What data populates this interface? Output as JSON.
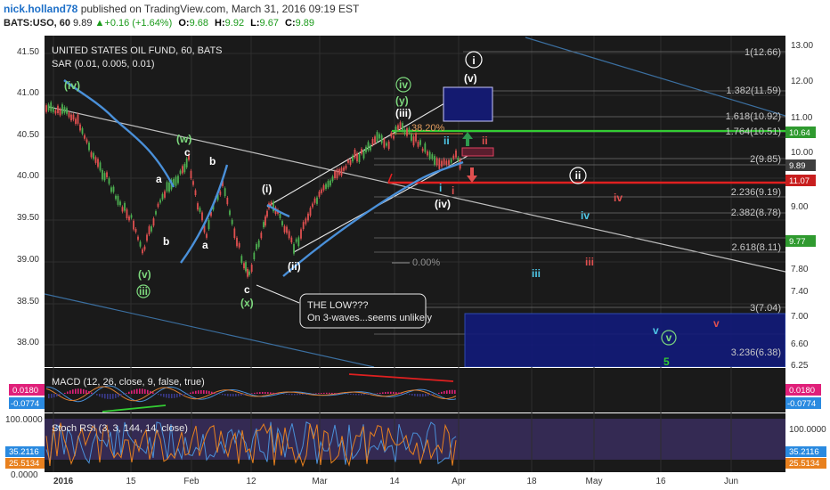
{
  "header": {
    "author": "nick.holland78",
    "published": "published on TradingView.com, March 31, 2016 09:19 EST",
    "symbol": "BATS:USO, 60",
    "last": "9.89",
    "change": "+0.16 (+1.64%)",
    "o_label": "O:",
    "o": "9.68",
    "h_label": "H:",
    "h": "9.92",
    "l_label": "L:",
    "l": "9.67",
    "c_label": "C:",
    "c": "9.89"
  },
  "chart": {
    "title": "UNITED STATES OIL FUND, 60, BATS",
    "sar_label": "SAR (0.01, 0.005, 0.01)",
    "left_ticks": [
      "41.50",
      "41.00",
      "40.50",
      "40.00",
      "39.50",
      "39.00",
      "38.50",
      "38.00"
    ],
    "right_ticks": [
      "13.00",
      "12.00",
      "11.00",
      "10.00",
      "9.00",
      "7.80",
      "7.40",
      "7.00",
      "6.60",
      "6.25"
    ],
    "price_tags": [
      "10.64",
      "9.89",
      "11.07",
      "9.77"
    ],
    "fib_levels": [
      "1(12.66)",
      "1.382(11.59)",
      "1.618(10.92)",
      "1.764(10.51)",
      "2(9.85)",
      "2.236(9.19)",
      "2.382(8.78)",
      "2.618(8.11)",
      "3(7.04)",
      "3.236(6.38)"
    ],
    "fib_38": "38.20%",
    "fib_0": "0.00%",
    "annotation_title": "THE LOW???",
    "annotation_text": "On 3-waves...seems unlikely",
    "x_ticks": [
      "2016",
      "15",
      "Feb",
      "12",
      "Mar",
      "14",
      "Apr",
      "18",
      "May",
      "16",
      "Jun"
    ]
  },
  "waves": {
    "iv_green": "(iv)",
    "w_green": "(w)",
    "v_green": "(v)",
    "iii_green": "iii",
    "x_green": "(x)",
    "c_white": "c",
    "a1": "a",
    "b1": "b",
    "b2": "b",
    "a2": "a",
    "c2": "c",
    "i_paren": "(i)",
    "ii_paren": "(ii)",
    "iii_paren": "(iii)",
    "iv_paren": "(iv)",
    "v_paren": "(v)",
    "i_circle": "i",
    "ii_circle": "ii",
    "y_green": "(y)",
    "iv_circle_green": "iv",
    "ii_cyan": "ii",
    "ii_red": "ii",
    "i_cyan": "i",
    "i_red": "i",
    "iv_red": "iv",
    "iv_cyan": "iv",
    "iii_cyan": "iii",
    "iii_red": "iii",
    "v_cyan": "v",
    "v_circle_green": "v",
    "v_red": "v",
    "five_green": "5"
  },
  "macd": {
    "label": "MACD (12, 26, close, 9, false, true)",
    "value1": "0.0180",
    "value2": "-0.0774"
  },
  "stoch": {
    "label": "Stoch RSI (3, 3, 144, 14, close)",
    "top": "100.0000",
    "value1": "35.2116",
    "value2": "25.5134",
    "bottom": "0.0000"
  },
  "colors": {
    "panel_bg": "#1a1a1a",
    "sar": "#4a90d9",
    "green_line": "#33cc33",
    "red_line": "#e02020",
    "up_candle": "#4caf50",
    "down_candle": "#e05050"
  }
}
